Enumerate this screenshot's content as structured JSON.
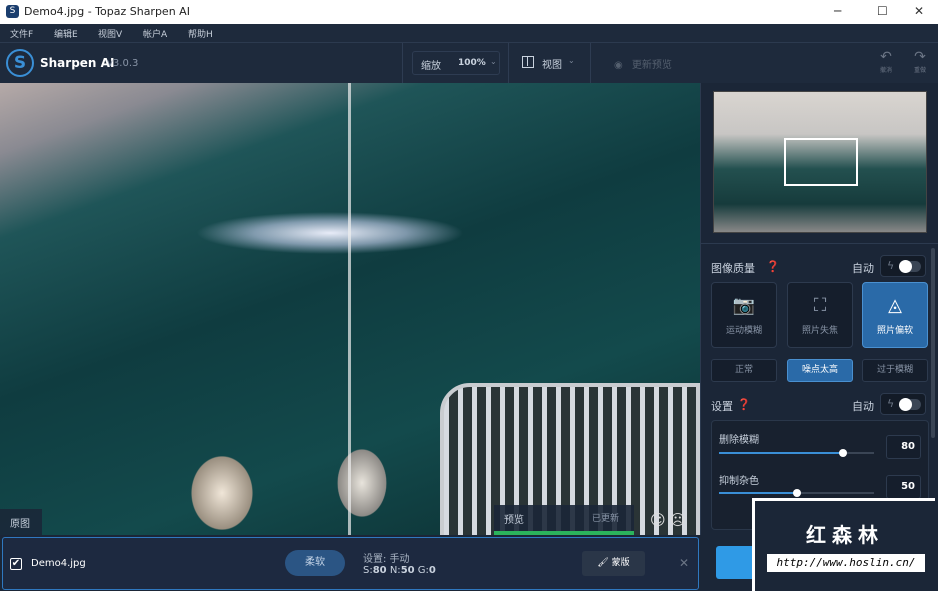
{
  "window": {
    "title": "Demo4.jpg - Topaz Sharpen AI",
    "controls": [
      "─",
      "☐",
      "✕"
    ]
  },
  "menu": [
    {
      "label": "文件F"
    },
    {
      "label": "编辑E"
    },
    {
      "label": "视图V"
    },
    {
      "label": "帐户A"
    },
    {
      "label": "帮助H"
    }
  ],
  "app": {
    "name": "Sharpen AI",
    "version": "v3.0.3",
    "accent": "#3a8fd6"
  },
  "toolbar": {
    "zoom_label": "缩放",
    "zoom_value": "100%",
    "view_label": "视图",
    "update_preview": "更新预览",
    "undo": "撤消",
    "redo": "重做"
  },
  "canvas": {
    "original_label": "原图",
    "preview_label": "预览",
    "preview_status": "已更新",
    "preview_progress": 100
  },
  "panel": {
    "image_quality": "图像质量",
    "auto": "自动",
    "modes": [
      {
        "label": "运动模糊",
        "selected": false
      },
      {
        "label": "照片失焦",
        "selected": false
      },
      {
        "label": "照片偏软",
        "selected": true
      }
    ],
    "noise": [
      {
        "label": "正常",
        "selected": false
      },
      {
        "label": "噪点太高",
        "selected": true
      },
      {
        "label": "过于模糊",
        "selected": false
      }
    ],
    "settings": "设置",
    "sliders": [
      {
        "label": "删除模糊",
        "value": "80",
        "fraction": 0.8
      },
      {
        "label": "抑制杂色",
        "value": "50",
        "fraction": 0.5
      }
    ]
  },
  "bottom": {
    "filename": "Demo4.jpg",
    "mode_badge": "柔软",
    "settings_line": "设置: 手动",
    "s_label": "S:",
    "s": "80",
    "n_label": "N:",
    "n": "50",
    "g_label": "G:",
    "g": "0",
    "mask": "蒙版",
    "close": "✕"
  },
  "watermark": {
    "title": "红森林",
    "url": "http://www.hoslin.cn/"
  }
}
